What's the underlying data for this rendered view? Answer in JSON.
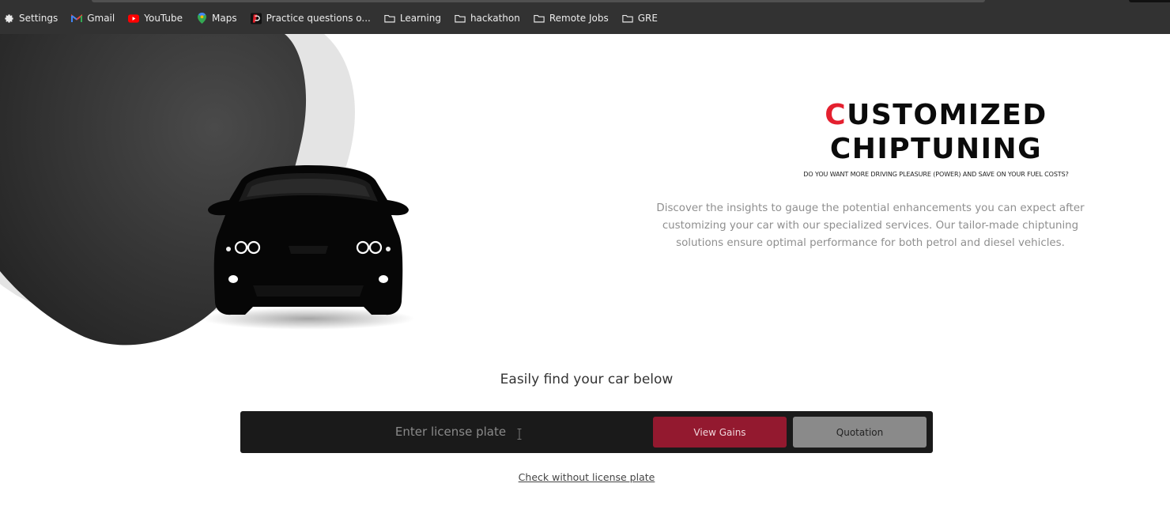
{
  "bookmarks": [
    {
      "label": "Settings",
      "icon": "gear-icon"
    },
    {
      "label": "Gmail",
      "icon": "gmail-icon"
    },
    {
      "label": "YouTube",
      "icon": "youtube-icon"
    },
    {
      "label": "Maps",
      "icon": "maps-pin-icon"
    },
    {
      "label": "Practice questions o...",
      "icon": "practice-site-icon"
    },
    {
      "label": "Learning",
      "icon": "folder-icon"
    },
    {
      "label": "hackathon",
      "icon": "folder-icon"
    },
    {
      "label": "Remote Jobs",
      "icon": "folder-icon"
    },
    {
      "label": "GRE",
      "icon": "folder-icon"
    }
  ],
  "hero": {
    "title_first_letter": "C",
    "title_line1_rest": "USTOMIZED",
    "title_line2": "CHIPTUNING",
    "subtitle": "DO YOU WANT MORE DRIVING PLEASURE (POWER) AND SAVE ON YOUR FUEL COSTS?",
    "description": "Discover the insights to gauge the potential enhancements you can expect after customizing your car with our specialized services. Our tailor-made chiptuning solutions ensure optimal performance for both petrol and diesel vehicles.",
    "accent_color": "#e4202f"
  },
  "finder": {
    "heading": "Easily find your car below",
    "plate_placeholder": "Enter license plate",
    "plate_value": "",
    "view_gains_label": "View Gains",
    "quotation_label": "Quotation",
    "check_link": "Check without license plate",
    "gains_color": "#93192f"
  }
}
